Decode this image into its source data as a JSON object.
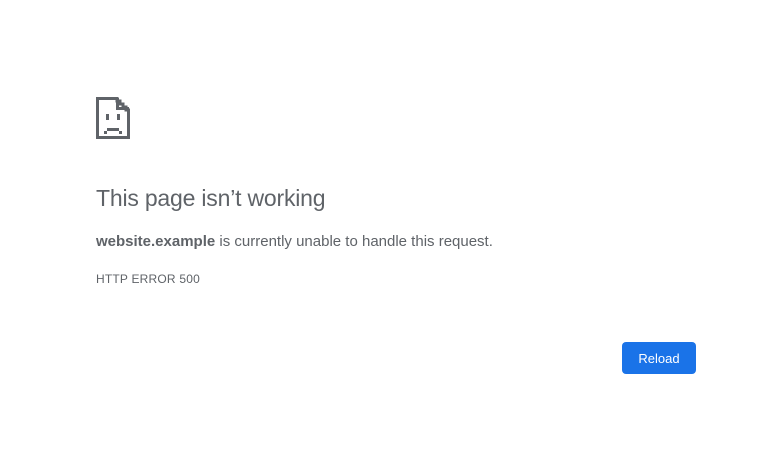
{
  "error_page": {
    "icon": "sad-page-icon",
    "title": "This page isn’t working",
    "host": "website.example",
    "message_suffix": " is currently unable to handle this request.",
    "error_code": "HTTP ERROR 500",
    "reload_label": "Reload"
  },
  "colors": {
    "text": "#5f6368",
    "button_bg": "#1a73e8",
    "button_text": "#ffffff",
    "background": "#ffffff"
  }
}
